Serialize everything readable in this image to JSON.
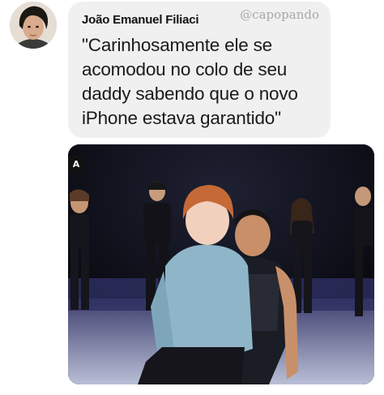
{
  "post": {
    "author_name": "João Emanuel Filiaci",
    "watermark": "@capopando",
    "message": "\"Carinhosamente ele se\nacomodou no colo de seu\ndaddy sabendo que o novo\niPhone estava garantido\""
  },
  "photo": {
    "corner_badge": "A"
  },
  "colors": {
    "bubble_background": "#f0f0f0",
    "author_text": "#111111",
    "message_text": "#1a1a1a",
    "watermark_text": "#a8a8a8",
    "stage_background": "#0a0b12"
  }
}
